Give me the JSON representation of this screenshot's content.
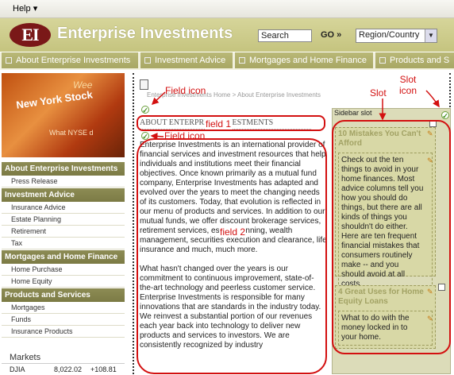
{
  "menubar": {
    "help": "Help",
    "help_arrow": "▾"
  },
  "header": {
    "logo_text": "EI",
    "brand": "Enterprise Investments",
    "search_value": "Search",
    "go_label": "GO »",
    "region_value": "Region/Country"
  },
  "nav": {
    "tabs": [
      {
        "label": "About Enterprise Investments"
      },
      {
        "label": "Investment Advice"
      },
      {
        "label": "Mortgages and Home Finance"
      },
      {
        "label": "Products and S"
      }
    ]
  },
  "hero": {
    "line1": "New York Stock",
    "line2": "Wee",
    "line3": "What NYSE d"
  },
  "sidebar": {
    "sections": [
      {
        "title": "About Enterprise Investments",
        "items": [
          "Press Release"
        ]
      },
      {
        "title": "Investment Advice",
        "items": [
          "Insurance Advice",
          "Estate Planning",
          "Retirement",
          "Tax"
        ]
      },
      {
        "title": "Mortgages and Home Finance",
        "items": [
          "Home Purchase",
          "Home Equity"
        ]
      },
      {
        "title": "Products and Services",
        "items": [
          "Mortgages",
          "Funds",
          "Insurance Products"
        ]
      }
    ],
    "markets_title": "Markets",
    "markets": [
      {
        "name": "DJIA",
        "value": "8,022.02",
        "change": "+108.81"
      }
    ]
  },
  "content": {
    "breadcrumb": "Enterprise Investments Home  >  About Enterprise Investments",
    "title": "ABOUT ENTERPRISE INVESTMENTS",
    "body_paragraphs": [
      "Enterprise Investments is an international provider of financial services and investment resources that help individuals and institutions meet their financial objectives. Once known primarily as a mutual fund company, Enterprise Investments has adapted and evolved over the years to meet the changing needs of its customers. Today, that evolution is reflected in our menu of products and services. In addition to our mutual funds, we offer discount brokerage services, retirement services, estate planning, wealth management, securities execution and clearance, life insurance and much, much more.",
      "What hasn't changed over the years is our commitment to continuous improvement, state-of-the-art technology and peerless customer service. Enterprise Investments is responsible for many innovations that are standards in the industry today. We reinvest a substantial portion of our revenues each year back into technology to deliver new products and services to investors. We are consistently recognized by industry"
    ]
  },
  "slot": {
    "label": "Sidebar slot",
    "cards": [
      {
        "title": "10 Mistakes You Can't Afford",
        "body": "Check out the ten things to avoid in your home finances.  Most advice columns tell you how you should do things, but there are all kinds of things you shouldn't do either. Here are ten frequent financial mistakes that consumers routinely make -- and you should avoid at all costs."
      },
      {
        "title": "4 Great Uses for Home Equity Loans",
        "body": "What to do with the money locked in to your home."
      }
    ]
  },
  "annotations": {
    "field_icon_1": "Field icon",
    "field_icon_2": "Field icon",
    "field_1": "field 1",
    "field_2": "field 2",
    "slot": "Slot",
    "slot_icon": "Slot\nicon"
  },
  "colors": {
    "annotation": "#d31010",
    "nav": "#a8a764",
    "header": "#c5c47f",
    "section": "#7c7b45"
  }
}
